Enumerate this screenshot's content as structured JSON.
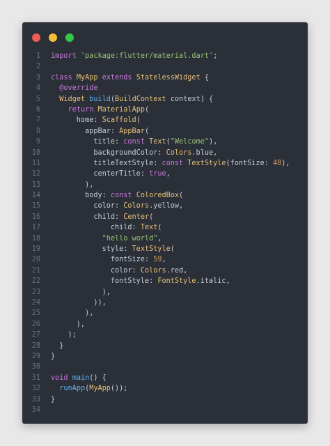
{
  "window": {
    "controls": [
      {
        "name": "close",
        "color": "#ee5c54"
      },
      {
        "name": "minimize",
        "color": "#f5bd32"
      },
      {
        "name": "maximize",
        "color": "#33c748"
      }
    ]
  },
  "colors": {
    "background": "#2b2f37",
    "keyword": "#c678dd",
    "string": "#98c379",
    "type": "#e5c07b",
    "function": "#61afef",
    "number": "#d19a66",
    "plain": "#c8ccd4",
    "line_number": "#6b717d"
  },
  "code": {
    "lines": [
      {
        "n": "1",
        "tokens": [
          {
            "t": "import",
            "c": "kw"
          },
          {
            "t": " ",
            "c": "pl"
          },
          {
            "t": "'package:flutter/material.dart'",
            "c": "str"
          },
          {
            "t": ";",
            "c": "pl"
          }
        ]
      },
      {
        "n": "2",
        "tokens": []
      },
      {
        "n": "3",
        "tokens": [
          {
            "t": "class",
            "c": "kw"
          },
          {
            "t": " ",
            "c": "pl"
          },
          {
            "t": "MyApp",
            "c": "ty"
          },
          {
            "t": " ",
            "c": "pl"
          },
          {
            "t": "extends",
            "c": "kw"
          },
          {
            "t": " ",
            "c": "pl"
          },
          {
            "t": "StatelessWidget",
            "c": "ty"
          },
          {
            "t": " {",
            "c": "pl"
          }
        ]
      },
      {
        "n": "4",
        "tokens": [
          {
            "t": "  ",
            "c": "pl"
          },
          {
            "t": "@override",
            "c": "kw"
          }
        ]
      },
      {
        "n": "5",
        "tokens": [
          {
            "t": "  ",
            "c": "pl"
          },
          {
            "t": "Widget",
            "c": "ty"
          },
          {
            "t": " ",
            "c": "pl"
          },
          {
            "t": "build",
            "c": "fn"
          },
          {
            "t": "(",
            "c": "pl"
          },
          {
            "t": "BuildContext",
            "c": "ty"
          },
          {
            "t": " context) {",
            "c": "pl"
          }
        ]
      },
      {
        "n": "6",
        "tokens": [
          {
            "t": "    ",
            "c": "pl"
          },
          {
            "t": "return",
            "c": "kw"
          },
          {
            "t": " ",
            "c": "pl"
          },
          {
            "t": "MaterialApp",
            "c": "ty"
          },
          {
            "t": "(",
            "c": "pl"
          }
        ]
      },
      {
        "n": "7",
        "tokens": [
          {
            "t": "      home: ",
            "c": "pl"
          },
          {
            "t": "Scaffold",
            "c": "ty"
          },
          {
            "t": "(",
            "c": "pl"
          }
        ]
      },
      {
        "n": "8",
        "tokens": [
          {
            "t": "        appBar: ",
            "c": "pl"
          },
          {
            "t": "AppBar",
            "c": "ty"
          },
          {
            "t": "(",
            "c": "pl"
          }
        ]
      },
      {
        "n": "9",
        "tokens": [
          {
            "t": "          title: ",
            "c": "pl"
          },
          {
            "t": "const",
            "c": "kw"
          },
          {
            "t": " ",
            "c": "pl"
          },
          {
            "t": "Text",
            "c": "ty"
          },
          {
            "t": "(",
            "c": "pl"
          },
          {
            "t": "\"Welcome\"",
            "c": "str"
          },
          {
            "t": "),",
            "c": "pl"
          }
        ]
      },
      {
        "n": "10",
        "tokens": [
          {
            "t": "          backgroundColor: ",
            "c": "pl"
          },
          {
            "t": "Colors",
            "c": "ty"
          },
          {
            "t": ".blue,",
            "c": "pl"
          }
        ]
      },
      {
        "n": "11",
        "tokens": [
          {
            "t": "          titleTextStyle: ",
            "c": "pl"
          },
          {
            "t": "const",
            "c": "kw"
          },
          {
            "t": " ",
            "c": "pl"
          },
          {
            "t": "TextStyle",
            "c": "ty"
          },
          {
            "t": "(fontSize: ",
            "c": "pl"
          },
          {
            "t": "48",
            "c": "num"
          },
          {
            "t": "),",
            "c": "pl"
          }
        ]
      },
      {
        "n": "12",
        "tokens": [
          {
            "t": "          centerTitle: ",
            "c": "pl"
          },
          {
            "t": "true",
            "c": "kw"
          },
          {
            "t": ",",
            "c": "pl"
          }
        ]
      },
      {
        "n": "13",
        "tokens": [
          {
            "t": "        ),",
            "c": "pl"
          }
        ]
      },
      {
        "n": "14",
        "tokens": [
          {
            "t": "        body: ",
            "c": "pl"
          },
          {
            "t": "const",
            "c": "kw"
          },
          {
            "t": " ",
            "c": "pl"
          },
          {
            "t": "ColoredBox",
            "c": "ty"
          },
          {
            "t": "(",
            "c": "pl"
          }
        ]
      },
      {
        "n": "15",
        "tokens": [
          {
            "t": "          color: ",
            "c": "pl"
          },
          {
            "t": "Colors",
            "c": "ty"
          },
          {
            "t": ".yellow,",
            "c": "pl"
          }
        ]
      },
      {
        "n": "16",
        "tokens": [
          {
            "t": "          child: ",
            "c": "pl"
          },
          {
            "t": "Center",
            "c": "ty"
          },
          {
            "t": "(",
            "c": "pl"
          }
        ]
      },
      {
        "n": "17",
        "tokens": [
          {
            "t": "              child: ",
            "c": "pl"
          },
          {
            "t": "Text",
            "c": "ty"
          },
          {
            "t": "(",
            "c": "pl"
          }
        ]
      },
      {
        "n": "18",
        "tokens": [
          {
            "t": "            ",
            "c": "pl"
          },
          {
            "t": "\"hello world\"",
            "c": "str"
          },
          {
            "t": ",",
            "c": "pl"
          }
        ]
      },
      {
        "n": "19",
        "tokens": [
          {
            "t": "            style: ",
            "c": "pl"
          },
          {
            "t": "TextStyle",
            "c": "ty"
          },
          {
            "t": "(",
            "c": "pl"
          }
        ]
      },
      {
        "n": "20",
        "tokens": [
          {
            "t": "              fontSize: ",
            "c": "pl"
          },
          {
            "t": "59",
            "c": "num"
          },
          {
            "t": ",",
            "c": "pl"
          }
        ]
      },
      {
        "n": "21",
        "tokens": [
          {
            "t": "              color: ",
            "c": "pl"
          },
          {
            "t": "Colors",
            "c": "ty"
          },
          {
            "t": ".red,",
            "c": "pl"
          }
        ]
      },
      {
        "n": "22",
        "tokens": [
          {
            "t": "              fontStyle: ",
            "c": "pl"
          },
          {
            "t": "FontStyle",
            "c": "ty"
          },
          {
            "t": ".italic,",
            "c": "pl"
          }
        ]
      },
      {
        "n": "23",
        "tokens": [
          {
            "t": "            ),",
            "c": "pl"
          }
        ]
      },
      {
        "n": "24",
        "tokens": [
          {
            "t": "          )),",
            "c": "pl"
          }
        ]
      },
      {
        "n": "25",
        "tokens": [
          {
            "t": "        ),",
            "c": "pl"
          }
        ]
      },
      {
        "n": "26",
        "tokens": [
          {
            "t": "      ),",
            "c": "pl"
          }
        ]
      },
      {
        "n": "27",
        "tokens": [
          {
            "t": "    );",
            "c": "pl"
          }
        ]
      },
      {
        "n": "28",
        "tokens": [
          {
            "t": "  }",
            "c": "pl"
          }
        ]
      },
      {
        "n": "29",
        "tokens": [
          {
            "t": "}",
            "c": "pl"
          }
        ]
      },
      {
        "n": "30",
        "tokens": []
      },
      {
        "n": "31",
        "tokens": [
          {
            "t": "void",
            "c": "kw"
          },
          {
            "t": " ",
            "c": "pl"
          },
          {
            "t": "main",
            "c": "fn"
          },
          {
            "t": "() {",
            "c": "pl"
          }
        ]
      },
      {
        "n": "32",
        "tokens": [
          {
            "t": "  ",
            "c": "pl"
          },
          {
            "t": "runApp",
            "c": "fn"
          },
          {
            "t": "(",
            "c": "pl"
          },
          {
            "t": "MyApp",
            "c": "ty"
          },
          {
            "t": "());",
            "c": "pl"
          }
        ]
      },
      {
        "n": "33",
        "tokens": [
          {
            "t": "}",
            "c": "pl"
          }
        ]
      },
      {
        "n": "34",
        "tokens": []
      }
    ]
  }
}
